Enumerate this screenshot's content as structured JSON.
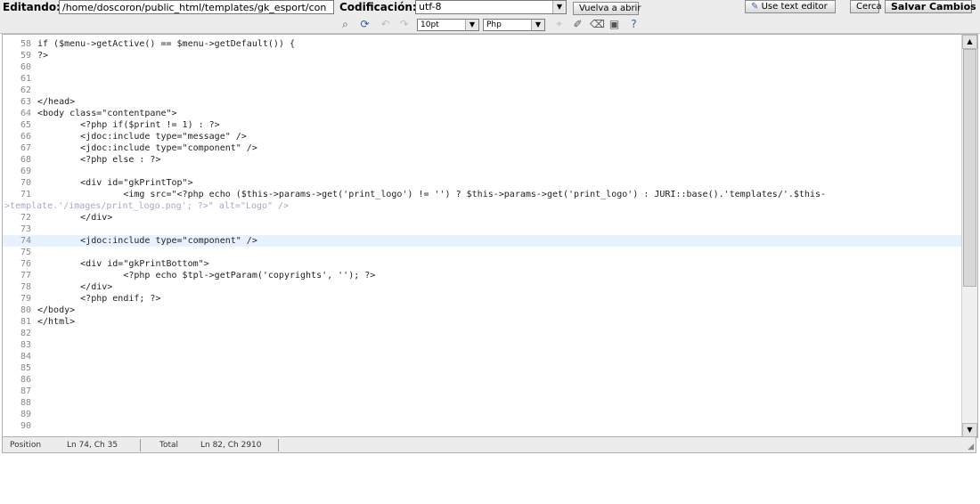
{
  "topbar": {
    "editing_label": "Editando:",
    "path_value": "/home/doscoron/public_html/templates/gk_esport/con",
    "encoding_label": "Codificación:",
    "encoding_value": "utf-8",
    "reopen_button": "Vuelva a abrir",
    "text_editor_button": "Use text editor",
    "close_button": "Cerca",
    "save_button": "Salvar Cambios"
  },
  "toolbar": {
    "font_size": "10pt",
    "syntax": "Php",
    "icons": [
      "search-icon",
      "replace-icon",
      "undo-icon",
      "redo-icon",
      "highlight-icon",
      "reset-icon",
      "clear-icon",
      "fullscreen-icon",
      "help-icon"
    ]
  },
  "editor": {
    "lines": [
      {
        "n": "58",
        "code": "if ($menu->getActive() == $menu->getDefault()) {"
      },
      {
        "n": "59",
        "code": "?>"
      },
      {
        "n": "60",
        "code": ""
      },
      {
        "n": "61",
        "code": ""
      },
      {
        "n": "62",
        "code": ""
      },
      {
        "n": "63",
        "code": "</head>"
      },
      {
        "n": "64",
        "code": "<body class=\"contentpane\">"
      },
      {
        "n": "65",
        "code": "        <?php if($print != 1) : ?>"
      },
      {
        "n": "66",
        "code": "        <jdoc:include type=\"message\" />"
      },
      {
        "n": "67",
        "code": "        <jdoc:include type=\"component\" />"
      },
      {
        "n": "68",
        "code": "        <?php else : ?>"
      },
      {
        "n": "69",
        "code": ""
      },
      {
        "n": "70",
        "code": "        <div id=\"gkPrintTop\">"
      },
      {
        "n": "71",
        "code": "                <img src=\"<?php echo ($this->params->get('print_logo') != '') ? $this->params->get('print_logo') : JURI::base().'templates/'.$this-"
      },
      {
        "n": "",
        "code": ">template.'/images/print_logo.png'; ?>\" alt=\"Logo\" />",
        "wrap": true
      },
      {
        "n": "72",
        "code": "        </div>"
      },
      {
        "n": "73",
        "code": ""
      },
      {
        "n": "74",
        "code": "        <jdoc:include type=\"component\" />",
        "highlight": true
      },
      {
        "n": "75",
        "code": ""
      },
      {
        "n": "76",
        "code": "        <div id=\"gkPrintBottom\">"
      },
      {
        "n": "77",
        "code": "                <?php echo $tpl->getParam('copyrights', ''); ?>"
      },
      {
        "n": "78",
        "code": "        </div>"
      },
      {
        "n": "79",
        "code": "        <?php endif; ?>"
      },
      {
        "n": "80",
        "code": "</body>"
      },
      {
        "n": "81",
        "code": "</html>"
      },
      {
        "n": "82",
        "code": ""
      },
      {
        "n": "83",
        "code": ""
      },
      {
        "n": "84",
        "code": ""
      },
      {
        "n": "85",
        "code": ""
      },
      {
        "n": "86",
        "code": ""
      },
      {
        "n": "87",
        "code": ""
      },
      {
        "n": "88",
        "code": ""
      },
      {
        "n": "89",
        "code": ""
      },
      {
        "n": "90",
        "code": ""
      }
    ]
  },
  "statusbar": {
    "position_label": "Position",
    "position_value": "Ln 74, Ch 35",
    "total_label": "Total",
    "total_value": "Ln 82, Ch 2910"
  }
}
